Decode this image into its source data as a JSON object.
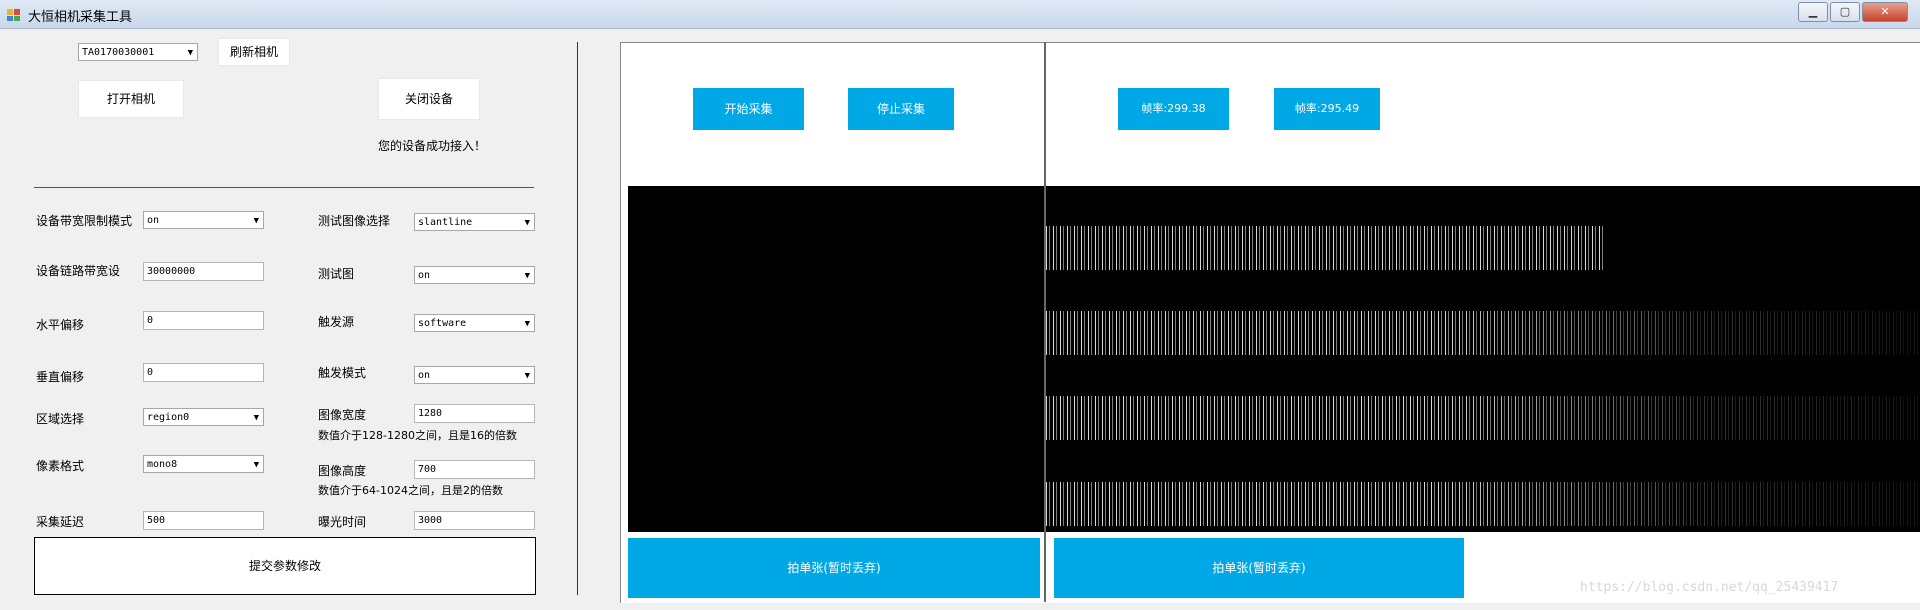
{
  "window": {
    "title": "大恒相机采集工具",
    "controls": [
      "minimize-icon",
      "maximize-icon",
      "close-icon"
    ],
    "control_glyphs": {
      "minimize": "▁",
      "maximize": "▢",
      "close": "✕"
    }
  },
  "device": {
    "camera_select": "TA0170030001",
    "refresh_label": "刷新相机",
    "open_label": "打开相机",
    "close_label": "关闭设备",
    "status": "您的设备成功接入！"
  },
  "params": {
    "bandwidth_mode_label": "设备带宽限制模式",
    "bandwidth_mode_value": "on",
    "link_bandwidth_label": "设备链路带宽设",
    "link_bandwidth_value": "30000000",
    "h_offset_label": "水平偏移",
    "h_offset_value": "0",
    "v_offset_label": "垂直偏移",
    "v_offset_value": "0",
    "region_label": "区域选择",
    "region_value": "region0",
    "pixel_format_label": "像素格式",
    "pixel_format_value": "mono8",
    "acq_delay_label": "采集延迟",
    "acq_delay_value": "500",
    "test_image_select_label": "测试图像选择",
    "test_image_select_value": "slantline",
    "test_image_label": "测试图",
    "test_image_value": "on",
    "trigger_source_label": "触发源",
    "trigger_source_value": "software",
    "trigger_mode_label": "触发模式",
    "trigger_mode_value": "on",
    "width_label": "图像宽度",
    "width_value": "1280",
    "width_hint": "数值介于128-1280之间，且是16的倍数",
    "height_label": "图像高度",
    "height_value": "700",
    "height_hint": "数值介于64-1024之间，且是2的倍数",
    "exposure_label": "曝光时间",
    "exposure_value": "3000",
    "submit_label": "提交参数修改"
  },
  "preview": {
    "start_label": "开始采集",
    "stop_label": "停止采集",
    "fps1": "帧率:299.38",
    "fps2": "帧率:295.49",
    "snap1": "拍单张(暂时丢弃)",
    "snap2": "拍单张(暂时丢弃)",
    "accent": "#00a8e6"
  },
  "watermark": "https://blog.csdn.net/qq_25439417"
}
